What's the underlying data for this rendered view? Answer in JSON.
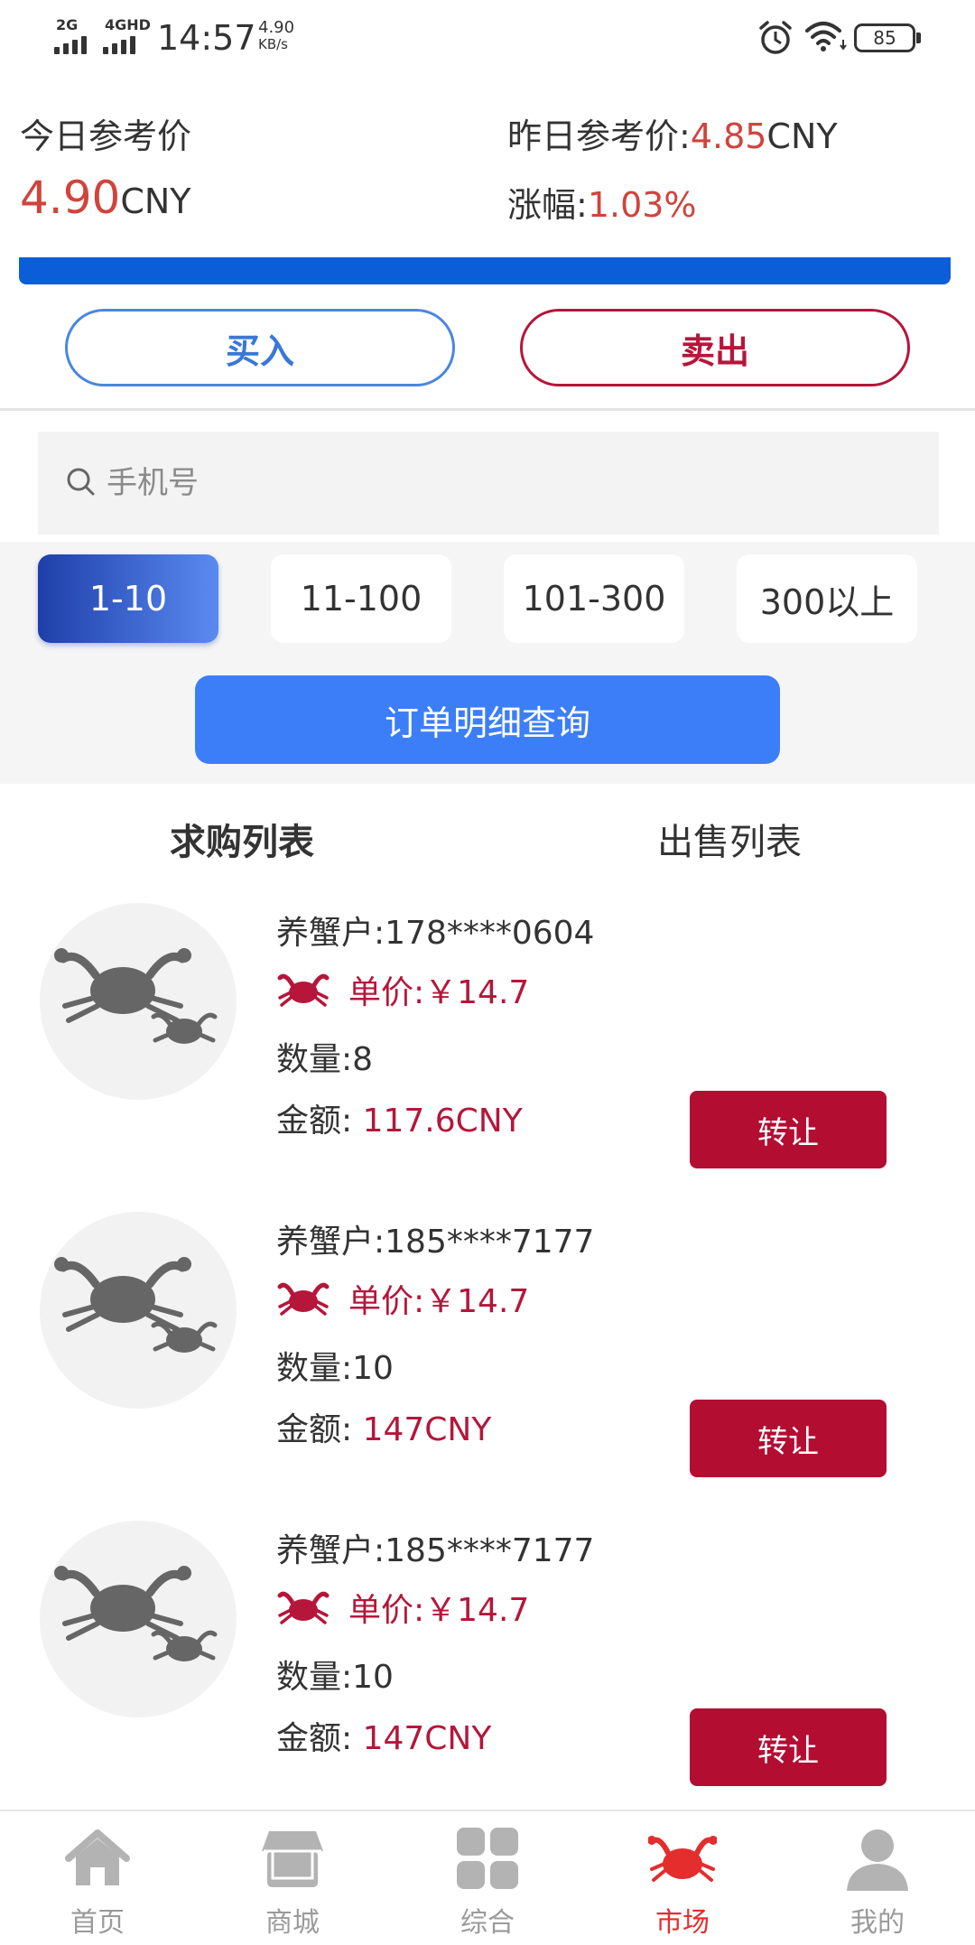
{
  "status": {
    "signal1": "2G",
    "signal2": "4GHD",
    "time": "14:57",
    "netspeed_value": "4.90",
    "netspeed_unit": "KB/s",
    "battery": "85"
  },
  "prices": {
    "today_label": "今日参考价",
    "today_value": "4.90",
    "today_unit": "CNY",
    "yesterday_label": "昨日参考价:",
    "yesterday_value": "4.85",
    "yesterday_unit": "CNY",
    "change_label": "涨幅:",
    "change_value": "1.03%"
  },
  "actions": {
    "buy": "买入",
    "sell": "卖出"
  },
  "search": {
    "placeholder": "手机号"
  },
  "ranges": [
    "1-10",
    "11-100",
    "101-300",
    "300以上"
  ],
  "order_query": "订单明细查询",
  "tabs": {
    "buy_list": "求购列表",
    "sell_list": "出售列表"
  },
  "items": [
    {
      "farmer": "养蟹户:178****0604",
      "price": "单价:￥14.7",
      "qty": "数量:8",
      "amount_label": "金额: ",
      "amount_value": "117.6CNY",
      "action": "转让"
    },
    {
      "farmer": "养蟹户:185****7177",
      "price": "单价:￥14.7",
      "qty": "数量:10",
      "amount_label": "金额: ",
      "amount_value": "147CNY",
      "action": "转让"
    },
    {
      "farmer": "养蟹户:185****7177",
      "price": "单价:￥14.7",
      "qty": "数量:10",
      "amount_label": "金额: ",
      "amount_value": "147CNY",
      "action": "转让"
    }
  ],
  "nav": {
    "home": "首页",
    "mall": "商城",
    "general": "综合",
    "market": "市场",
    "mine": "我的",
    "active": "market"
  },
  "colors": {
    "accent_red": "#b5163a",
    "price_red": "#d0443d",
    "primary_blue": "#3c7ef7",
    "bar_blue": "#0b5ed7"
  }
}
